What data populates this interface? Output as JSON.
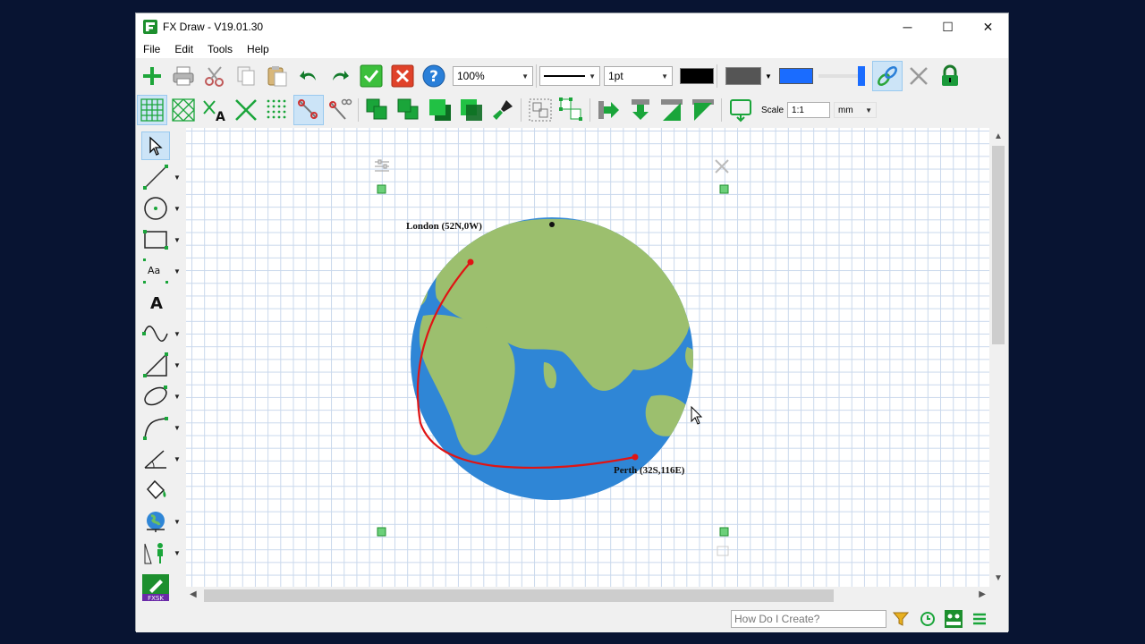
{
  "window": {
    "title": "FX Draw - V19.01.30",
    "controls": {
      "minimize": "─",
      "maximize": "☐",
      "close": "✕"
    }
  },
  "menu": [
    "File",
    "Edit",
    "Tools",
    "Help"
  ],
  "toolbar": {
    "zoom": "100%",
    "line_width": "1pt",
    "line_color": "#000000",
    "fill_color": "#555555",
    "highlight_color": "#1a6cff"
  },
  "toolbar2": {
    "scale_label": "Scale",
    "scale_value": "1:1",
    "units": "mm"
  },
  "globe": {
    "ocean_color": "#2f86d6",
    "land_color": "#9cbf6e",
    "route_color": "#e01414",
    "label_london": "London (52N,0W)",
    "label_perth": "Perth (32S,116E)"
  },
  "status": {
    "how_do_placeholder": "How Do I Create?"
  }
}
